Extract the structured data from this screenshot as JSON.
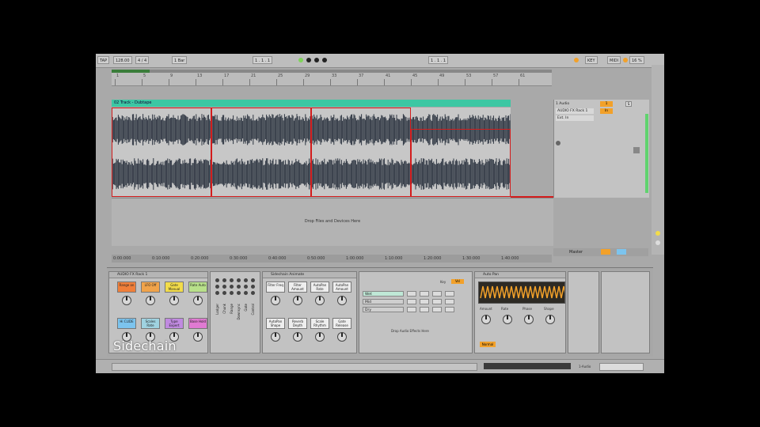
{
  "colors": {
    "accent": "#f2a12a",
    "clip": "#3cc7a3",
    "meter": "#60d36e",
    "marker": "#d31c1c"
  },
  "toolbar": {
    "tap": "TAP",
    "tempo": "128.00",
    "signature": "4 / 4",
    "quantize": "1 Bar",
    "cpu": "16 %",
    "midi_label": "MIDI",
    "key_label": "KEY",
    "position": "1 . 1 . 1",
    "loop_position": "1 . 1 . 1"
  },
  "ruler": {
    "labels": [
      "1",
      "5",
      "9",
      "13",
      "17",
      "21",
      "25",
      "29",
      "33",
      "37",
      "41",
      "45",
      "49",
      "53",
      "57",
      "61"
    ]
  },
  "clip": {
    "name": "02 Track - Dubtape"
  },
  "arrangement": {
    "drop_text": "Drop Files and Devices Here"
  },
  "timeline": {
    "labels": [
      "0:00:000",
      "0:10:000",
      "0:20:000",
      "0:30:000",
      "0:40:000",
      "0:50:000",
      "1:00:000",
      "1:10:000",
      "1:20:000",
      "1:30:000",
      "1:40:000"
    ]
  },
  "track": {
    "name": "1 Audio",
    "device_label": "AUDIO FX Rack 1",
    "io_label": "Ext. In",
    "number": "1",
    "solo": "S",
    "monitor": "In",
    "master": "Master"
  },
  "rack": {
    "title": "AUDIO FX Rack 1",
    "macros": [
      {
        "label": "Range\non",
        "color": "#f07f3a"
      },
      {
        "label": "LFO\nOff",
        "color": "#f0a34a"
      },
      {
        "label": "Gate\nManual",
        "color": "#f2dc4a"
      },
      {
        "label": "Rate\nAuto",
        "color": "#b8e08a"
      },
      {
        "label": "Hi\nCLIDE",
        "color": "#7cc4ee"
      },
      {
        "label": "Scales\nRate",
        "color": "#9fd2e0"
      },
      {
        "label": "Type\nExpert",
        "color": "#c08ae0"
      },
      {
        "label": "Base\nHold",
        "color": "#e07ad2"
      }
    ]
  },
  "chain_list": {
    "labels": [
      "Lodger",
      "Chunk",
      "Range",
      "Downsync",
      "Gate",
      "Control"
    ]
  },
  "sidechain_device": {
    "title": "Sidechain Animate",
    "buttons": [
      {
        "label": "Filter\nFreq"
      },
      {
        "label": "Filter\nAmount"
      },
      {
        "label": "AutoPan\nRate"
      },
      {
        "label": "AutoPan\nAmount"
      },
      {
        "label": "AutoPan\nShape"
      },
      {
        "label": "Reverb\nDepth"
      },
      {
        "label": "Scale\nRhythm"
      },
      {
        "label": "Gate\nRelease"
      }
    ]
  },
  "chains": {
    "rows": [
      {
        "name": "Wet"
      },
      {
        "name": "Mid"
      },
      {
        "name": "Dry"
      }
    ],
    "drop_text": "Drop Audio Effects Here",
    "key_label": "Key",
    "vel_label": "Vel"
  },
  "autopan": {
    "title": "Auto Pan",
    "params": [
      "Amount",
      "Rate",
      "Phase",
      "Shape"
    ],
    "mode": "Normal"
  },
  "overlay": {
    "sidechain": "Sidechain"
  },
  "status": {
    "label": "1-Audio"
  }
}
